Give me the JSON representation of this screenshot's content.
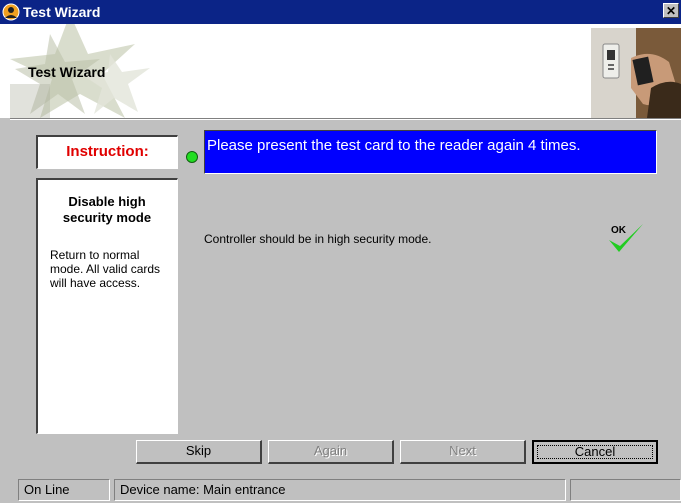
{
  "window": {
    "title": "Test Wizard",
    "close_glyph": "✕"
  },
  "header": {
    "title": "Test Wizard"
  },
  "instruction": {
    "label": "Instruction:",
    "step_title": "Disable high security mode",
    "step_description": "Return to normal mode. All valid cards will have access."
  },
  "prompt": {
    "text": "Please present the test card to the reader again 4 times."
  },
  "result": {
    "text": "Controller should be in high security mode.",
    "status_label": "OK"
  },
  "buttons": {
    "skip": "Skip",
    "again": "Again",
    "next": "Next",
    "cancel": "Cancel"
  },
  "statusbar": {
    "connection": "On Line",
    "device": "Device name: Main entrance",
    "extra": ""
  },
  "colors": {
    "title_bar": "#0b2487",
    "prompt_background": "#0000ff",
    "instruction_label": "#e00000",
    "status_indicator": "#22dd22",
    "check_mark": "#22cc22"
  },
  "icons": {
    "app": "user-circle-icon",
    "status_indicator": "green-dot-icon",
    "ok": "ok-check-icon"
  }
}
